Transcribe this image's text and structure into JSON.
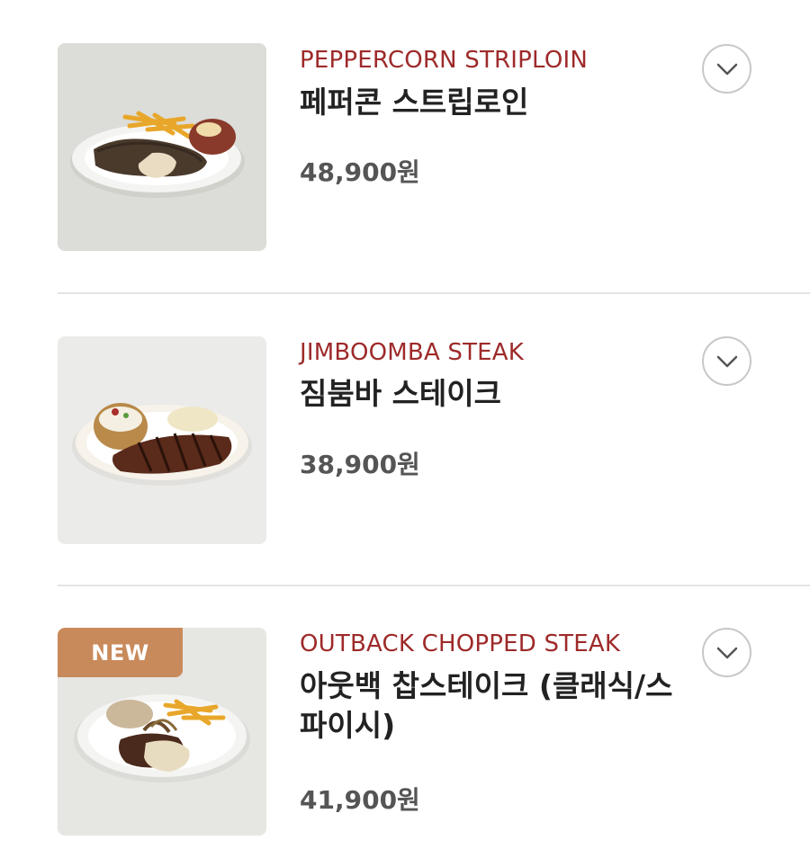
{
  "menu": {
    "items": [
      {
        "eng_name": "PEPPERCORN STRIPLOIN",
        "kor_name": "페퍼콘 스트립로인",
        "price": "48,900원",
        "image": "peppercorn-striploin-plate"
      },
      {
        "eng_name": "JIMBOOMBA STEAK",
        "kor_name": "짐붐바 스테이크",
        "price": "38,900원",
        "image": "jimboomba-steak-plate"
      },
      {
        "eng_name": "OUTBACK CHOPPED STEAK",
        "kor_name": "아웃백 찹스테이크 (클래식/스파이시)",
        "price": "41,900원",
        "badge": "NEW",
        "image": "chopped-steak-plate"
      }
    ]
  },
  "colors": {
    "eng_name": "#9e2a2a",
    "kor_name": "#222222",
    "price": "#555555",
    "badge_bg": "#c98a5b",
    "divider": "#e4e4e4"
  },
  "icons": {
    "expand": "chevron-down-icon"
  }
}
